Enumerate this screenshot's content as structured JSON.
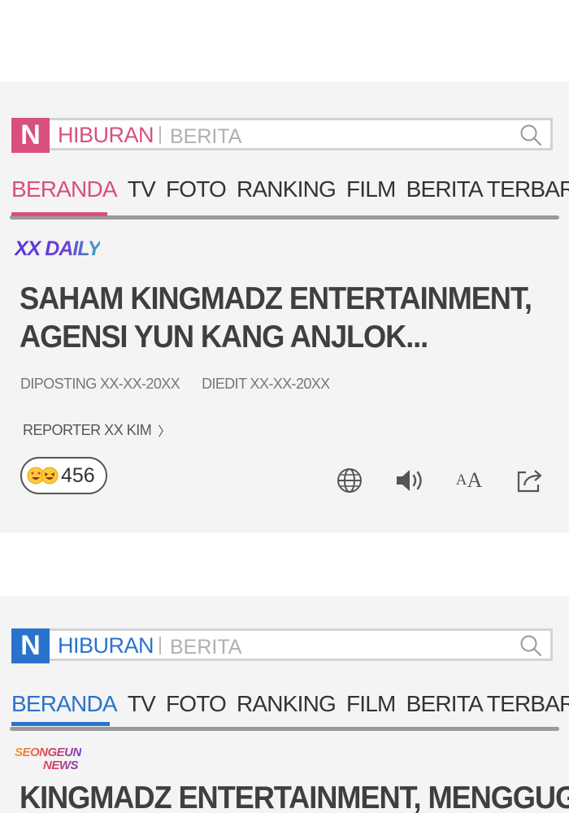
{
  "colors": {
    "panel_bg": "#f4f4f4",
    "accent_pink": "#d94f80",
    "accent_blue": "#2a73cc",
    "headline": "#3f3f3f",
    "nav_text": "#333333"
  },
  "nav_items": [
    "BERANDA",
    "TV",
    "FOTO",
    "RANKING",
    "FILM",
    "BERITA TERBARU"
  ],
  "panel1": {
    "logo": "N",
    "section": "HIBURAN",
    "subsection": "BERITA",
    "search_icon": "search-icon",
    "source": "XX DAILY",
    "headline_line1": "SAHAM KINGMADZ ENTERTAINMENT,",
    "headline_line2": "AGENSI YUN KANG ANJLOK...",
    "posted": "DIPOSTING XX-XX-20XX",
    "edited": "DIEDIT XX-XX-20XX",
    "reporter": "REPORTER XX KIM",
    "reporter_chevron": "〉",
    "reaction_count": "456",
    "tools": [
      "globe-icon",
      "speaker-icon",
      "font-size-icon",
      "share-icon"
    ],
    "font_size_label_small": "A",
    "font_size_label_large": "A"
  },
  "panel2": {
    "logo": "N",
    "section": "HIBURAN",
    "subsection": "BERITA",
    "search_icon": "search-icon",
    "source_line1": "SEONGEUN",
    "source_line2": "NEWS",
    "headline_line1": "KINGMADZ ENTERTAINMENT, MENGGUGAT"
  }
}
